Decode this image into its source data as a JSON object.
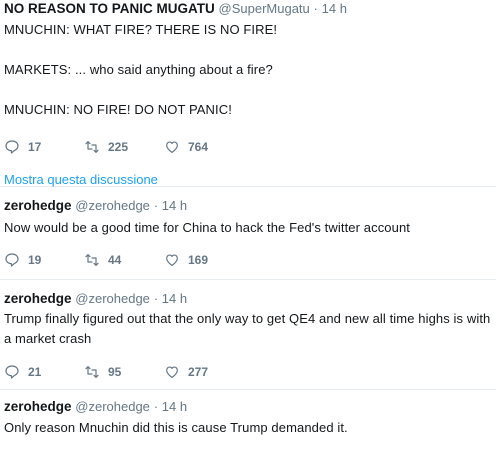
{
  "tweets": [
    {
      "name": "NO REASON TO PANIC MUGATU",
      "handle": "@SuperMugatu",
      "separator": "·",
      "time": "14 h",
      "text": "MNUCHIN: WHAT FIRE? THERE IS NO FIRE!\n\nMARKETS: ... who said anything about a fire?\n\nMNUCHIN: NO FIRE! DO NOT PANIC!",
      "replies": "17",
      "retweets": "225",
      "likes": "764",
      "show_thread": "Mostra questa discussione"
    },
    {
      "name": "zerohedge",
      "handle": "@zerohedge",
      "separator": "·",
      "time": "14 h",
      "text": "Now would be a good time for China to hack the Fed's twitter account",
      "replies": "19",
      "retweets": "44",
      "likes": "169"
    },
    {
      "name": "zerohedge",
      "handle": "@zerohedge",
      "separator": "·",
      "time": "14 h",
      "text": "Trump finally figured out that the only way to get QE4 and new all time highs is with a market crash",
      "replies": "21",
      "retweets": "95",
      "likes": "277"
    },
    {
      "name": "zerohedge",
      "handle": "@zerohedge",
      "separator": "·",
      "time": "14 h",
      "text": "Only reason Mnuchin did this is cause Trump demanded it."
    }
  ],
  "colors": {
    "text": "#14171a",
    "secondary": "#657786",
    "link": "#1da1f2",
    "divider": "#e6ecf0"
  },
  "icons": [
    "reply-icon",
    "retweet-icon",
    "like-icon"
  ]
}
